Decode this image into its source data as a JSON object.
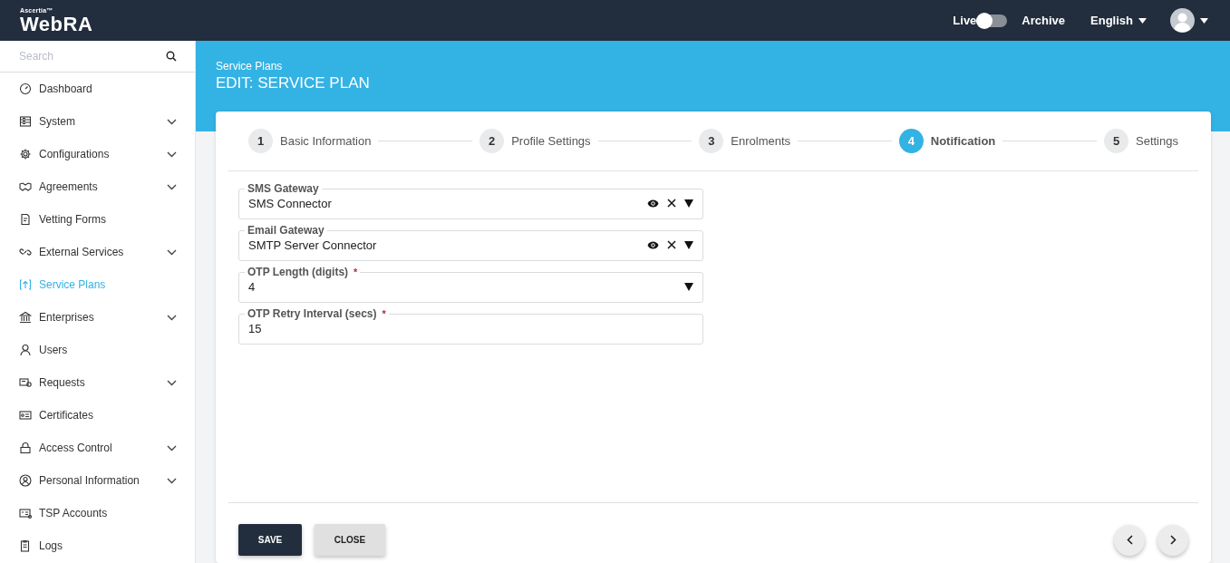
{
  "header": {
    "brand_small": "Ascertia™",
    "brand": "WebRA",
    "mode_toggle": {
      "left_label": "Live",
      "right_label": "Archive",
      "on": false
    },
    "language": "English"
  },
  "sidebar": {
    "search": {
      "placeholder": "Search"
    },
    "items": [
      {
        "label": "Dashboard",
        "expandable": false,
        "selected": false
      },
      {
        "label": "System",
        "expandable": true,
        "selected": false
      },
      {
        "label": "Configurations",
        "expandable": true,
        "selected": false
      },
      {
        "label": "Agreements",
        "expandable": true,
        "selected": false
      },
      {
        "label": "Vetting Forms",
        "expandable": false,
        "selected": false
      },
      {
        "label": "External Services",
        "expandable": true,
        "selected": false
      },
      {
        "label": "Service Plans",
        "expandable": false,
        "selected": true
      },
      {
        "label": "Enterprises",
        "expandable": true,
        "selected": false
      },
      {
        "label": "Users",
        "expandable": false,
        "selected": false
      },
      {
        "label": "Requests",
        "expandable": true,
        "selected": false
      },
      {
        "label": "Certificates",
        "expandable": false,
        "selected": false
      },
      {
        "label": "Access Control",
        "expandable": true,
        "selected": false
      },
      {
        "label": "Personal Information",
        "expandable": true,
        "selected": false
      },
      {
        "label": "TSP Accounts",
        "expandable": false,
        "selected": false
      },
      {
        "label": "Logs",
        "expandable": false,
        "selected": false
      }
    ]
  },
  "page": {
    "breadcrumb": "Service Plans",
    "title": "EDIT: SERVICE PLAN"
  },
  "steps": [
    {
      "number": "1",
      "label": "Basic Information",
      "selected": false
    },
    {
      "number": "2",
      "label": "Profile Settings",
      "selected": false
    },
    {
      "number": "3",
      "label": "Enrolments",
      "selected": false
    },
    {
      "number": "4",
      "label": "Notification",
      "selected": true
    },
    {
      "number": "5",
      "label": "Settings",
      "selected": false
    }
  ],
  "fields": [
    {
      "kind": "select",
      "label": "SMS Gateway",
      "value": "SMS Connector",
      "viewable": true,
      "clearable": true
    },
    {
      "kind": "select",
      "label": "Email Gateway",
      "value": "SMTP Server Connector",
      "viewable": true,
      "clearable": true
    },
    {
      "kind": "select",
      "label": "OTP Length (digits)",
      "marker": "*",
      "value": "4",
      "viewable": false,
      "clearable": false
    },
    {
      "kind": "text",
      "label": "OTP Retry Interval (secs)",
      "marker": "*",
      "value": "15"
    }
  ],
  "buttons": [
    {
      "label": "SAVE",
      "kind": "primary"
    },
    {
      "label": "CLOSE",
      "kind": "secondary"
    }
  ]
}
